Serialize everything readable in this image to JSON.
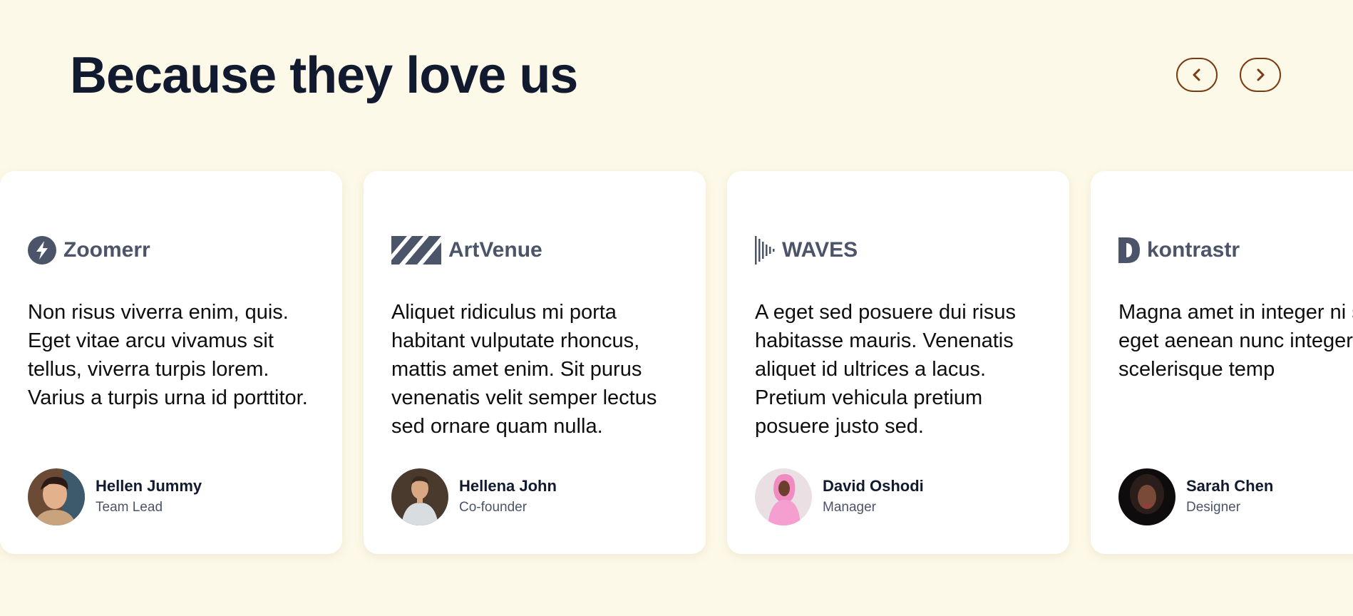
{
  "section": {
    "title": "Because they love us"
  },
  "navigation": {
    "prev_icon": "chevron-left-icon",
    "next_icon": "chevron-right-icon",
    "accent_color": "#7a3a12"
  },
  "colors": {
    "background": "#fdf9e8",
    "card": "#ffffff",
    "heading": "#111a2e",
    "logo": "#4b5468"
  },
  "testimonials": [
    {
      "company": "Zoomerr",
      "logo_icon": "bolt-circle-icon",
      "quote": "Non risus viverra enim, quis. Eget vitae arcu vivamus sit tellus, viverra turpis lorem. Varius a turpis urna id porttitor.",
      "author_name": "Hellen Jummy",
      "author_role": "Team Lead"
    },
    {
      "company": "ArtVenue",
      "logo_icon": "diagonal-stripes-icon",
      "quote": "Aliquet ridiculus mi porta habitant vulputate rhoncus, mattis amet enim. Sit purus venenatis velit semper lectus sed ornare quam nulla.",
      "author_name": "Hellena John",
      "author_role": "Co-founder"
    },
    {
      "company": "WAVES",
      "logo_icon": "sound-bars-icon",
      "quote": "A eget sed posuere dui risus habitasse mauris. Venenatis aliquet id ultrices a lacus. Pretium vehicula pretium posuere justo sed.",
      "author_name": "David Oshodi",
      "author_role": "Manager"
    },
    {
      "company": "kontrastr",
      "logo_icon": "contrast-d-icon",
      "quote": "Magna amet in integer ni sit. Ut eget aenean nunc integer scelerisque temp",
      "author_name": "Sarah Chen",
      "author_role": "Designer"
    }
  ]
}
